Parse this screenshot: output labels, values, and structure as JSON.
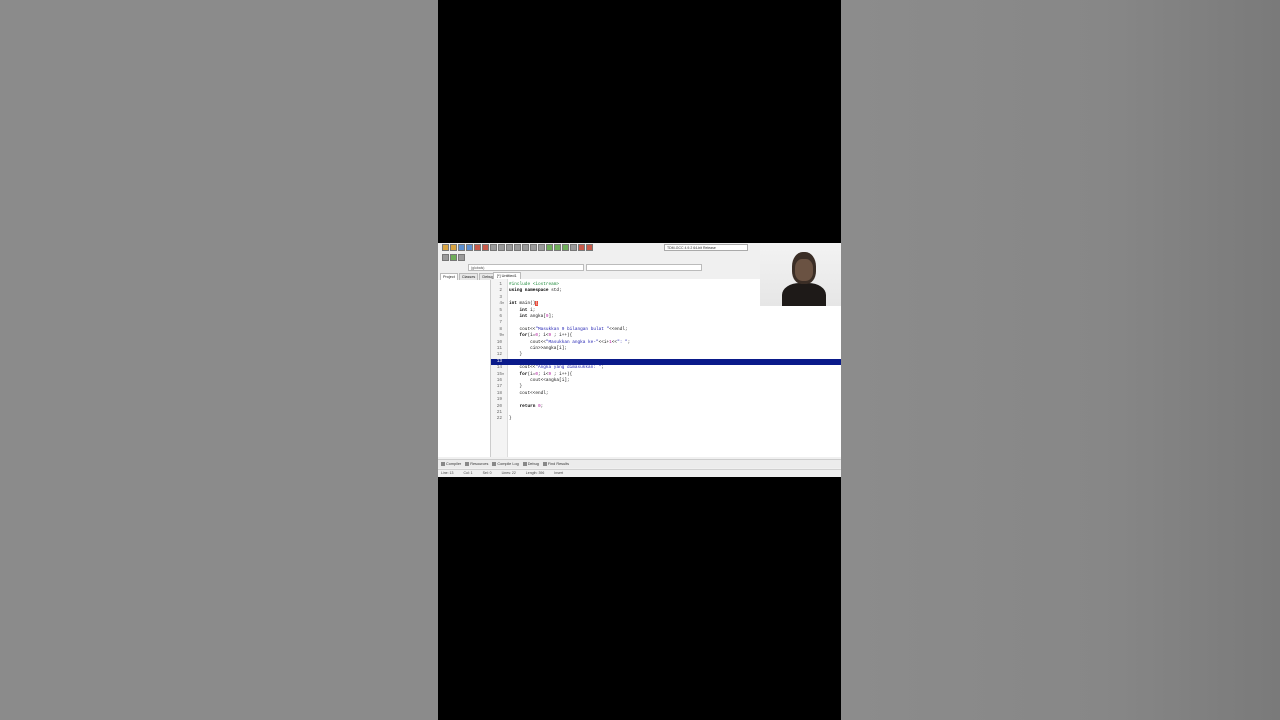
{
  "ide": {
    "compiler_select": "TDM-GCC 4.9.2 64-bit Release",
    "scope_placeholder": "(globals)",
    "left_tabs": [
      "Project",
      "Classes",
      "Debug"
    ],
    "file_tab": "[*] Untitled1",
    "code_lines": [
      {
        "n": "1",
        "html": "<span class='cm'>#include &lt;iostream&gt;</span>"
      },
      {
        "n": "2",
        "html": "<span class='kw'>using namespace</span> std;"
      },
      {
        "n": "3",
        "html": ""
      },
      {
        "n": "4",
        "html": "<span class='kw'>int</span> main()<span class='brk'>{</span>"
      },
      {
        "n": "5",
        "html": "    <span class='kw'>int</span> i;"
      },
      {
        "n": "6",
        "html": "    <span class='kw'>int</span> angka[<span class='num'>9</span>];"
      },
      {
        "n": "7",
        "html": ""
      },
      {
        "n": "8",
        "html": "    cout&lt;&lt;<span class='str'>\"Masukkan 9 bilangan bulat \"</span>&lt;&lt;endl;"
      },
      {
        "n": "9",
        "html": "    <span class='kw'>for</span>(i=<span class='num'>0</span>; i&lt;<span class='num'>9</span> ; i++){"
      },
      {
        "n": "10",
        "html": "        cout&lt;&lt;<span class='str'>\"Masukkan angka ke-\"</span>&lt;&lt;i+<span class='num'>1</span>&lt;&lt;<span class='str'>\": \"</span>;"
      },
      {
        "n": "11",
        "html": "        cin&gt;&gt;angka[i];"
      },
      {
        "n": "12",
        "html": "    }"
      },
      {
        "n": "13",
        "html": "",
        "highlight": true
      },
      {
        "n": "14",
        "html": "    cout&lt;&lt;<span class='str'>\"Angka yang dimasukkan: \"</span>;"
      },
      {
        "n": "15",
        "html": "    <span class='kw'>for</span>(i=<span class='num'>0</span>; i&lt;<span class='num'>9</span> ; i++){"
      },
      {
        "n": "16",
        "html": "        cout&lt;&lt;angka[i];"
      },
      {
        "n": "17",
        "html": "    }"
      },
      {
        "n": "18",
        "html": "    cout&lt;&lt;endl;"
      },
      {
        "n": "19",
        "html": ""
      },
      {
        "n": "20",
        "html": "    <span class='kw'>return</span> <span class='num'>0</span>;"
      },
      {
        "n": "21",
        "html": ""
      },
      {
        "n": "22",
        "html": "}"
      }
    ],
    "bottom_tabs": [
      "Compiler",
      "Resources",
      "Compile Log",
      "Debug",
      "Find Results"
    ],
    "status": {
      "line": "Line: 13",
      "col": "Col: 1",
      "sel": "Sel: 0",
      "lines": "Lines: 22",
      "length": "Length: 396",
      "mode": "Insert"
    }
  }
}
